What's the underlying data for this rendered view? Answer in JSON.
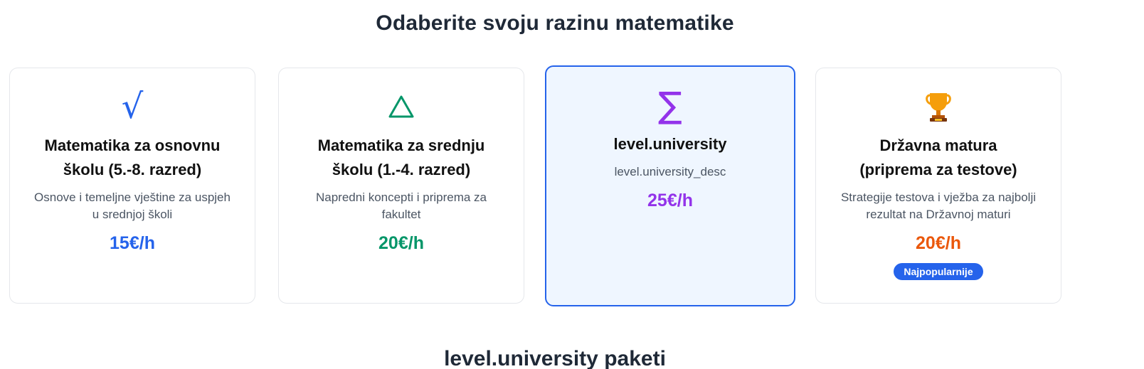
{
  "section_title": "Odaberite svoju razinu matematike",
  "cards": [
    {
      "icon": "square-root-icon",
      "icon_glyph": "√",
      "title": "Matematika za osnovnu školu (5.-8. razred)",
      "description": "Osnove i temeljne vještine za uspjeh u srednjoj školi",
      "price": "15€/h",
      "price_color": "#2563eb",
      "icon_color": "#2563eb",
      "selected": false
    },
    {
      "icon": "triangle-icon",
      "icon_glyph": "△",
      "title": "Matematika za srednju školu (1.-4. razred)",
      "description": "Napredni koncepti i priprema za fakultet",
      "price": "20€/h",
      "price_color": "#059669",
      "icon_color": "#059669",
      "selected": false
    },
    {
      "icon": "sigma-icon",
      "icon_glyph": "∑",
      "title": "level.university",
      "description": "level.university_desc",
      "price": "25€/h",
      "price_color": "#9333ea",
      "icon_color": "#9333ea",
      "selected": true
    },
    {
      "icon": "trophy-icon",
      "icon_glyph": "🏆",
      "title": "Državna matura (priprema za testove)",
      "description": "Strategije testova i vježba za najbolji rezultat na Državnoj maturi",
      "price": "20€/h",
      "price_color": "#ea580c",
      "icon_color": "#d97706",
      "selected": false,
      "badge": "Najpopularnije"
    }
  ],
  "bottom_title": "level.university paketi",
  "colors": {
    "selected_border": "#2563eb",
    "selected_background": "#eff6ff",
    "badge_background": "#2563eb"
  }
}
